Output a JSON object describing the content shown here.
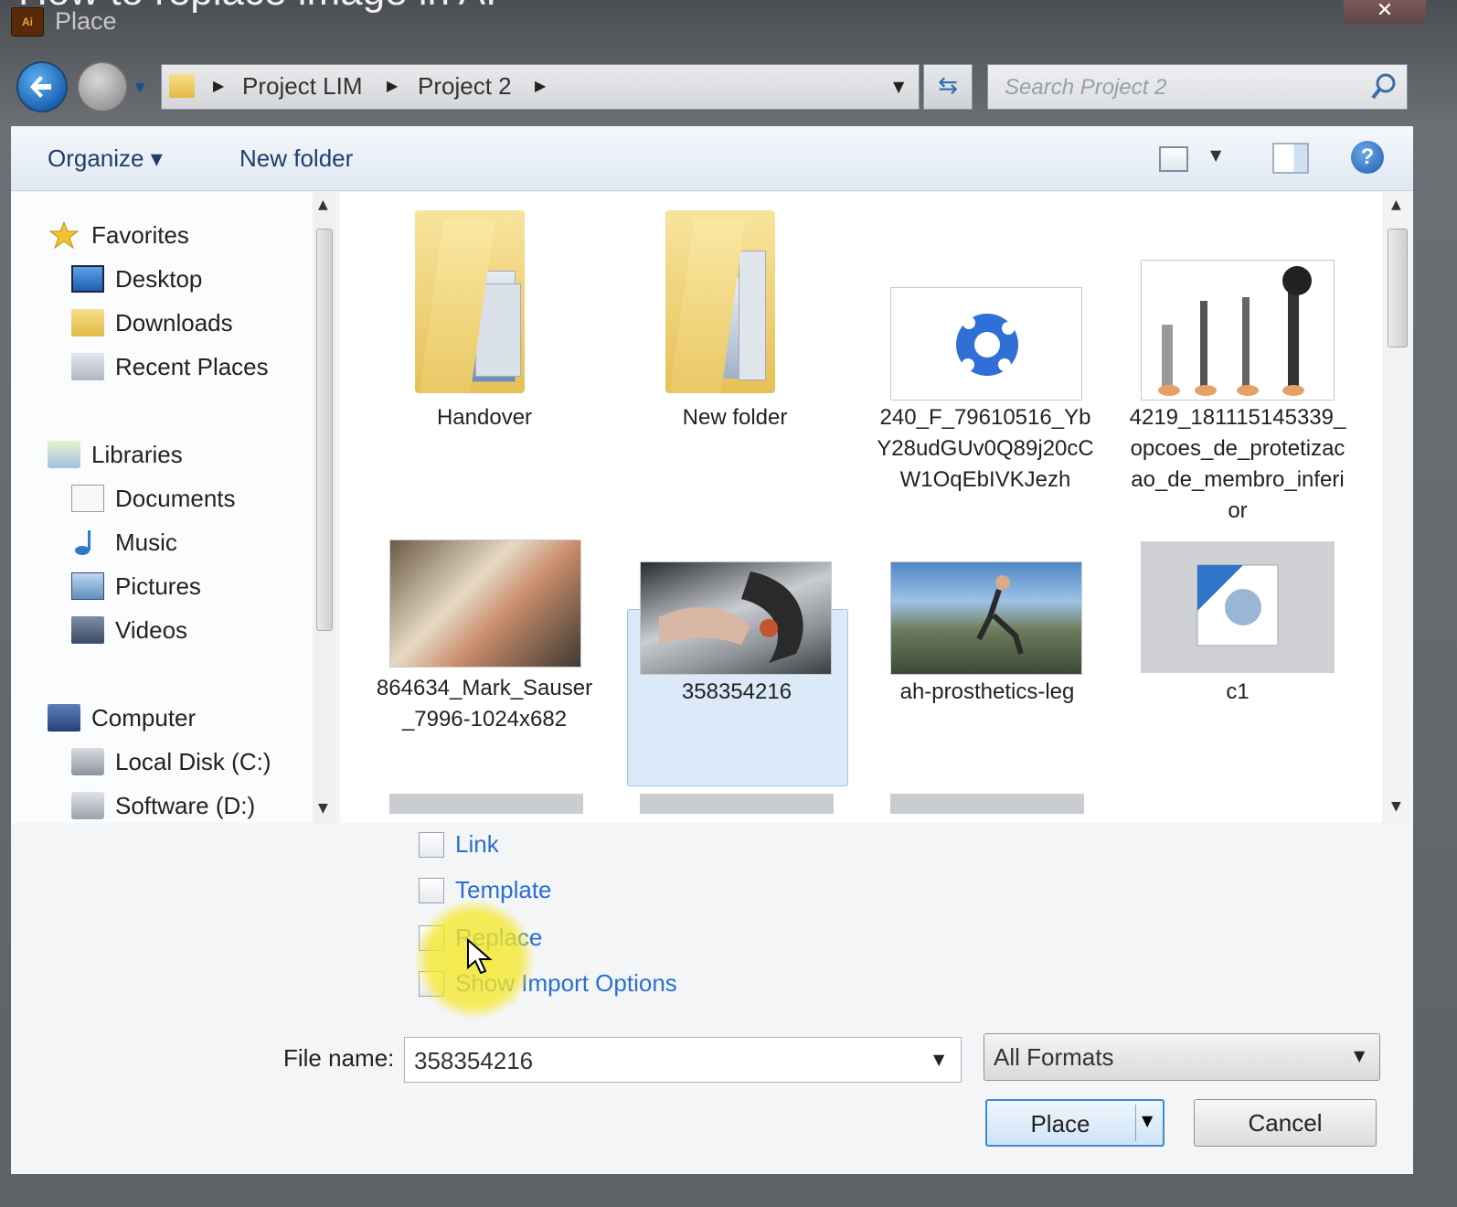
{
  "video_caption": "How to replace image in AI",
  "window": {
    "app_icon_text": "Ai",
    "title": "Place",
    "close_symbol": "✕"
  },
  "address_bar": {
    "breadcrumbs": [
      "Project LIM",
      "Project 2"
    ],
    "search_placeholder": "Search Project 2"
  },
  "toolbar": {
    "organize_label": "Organize ▾",
    "new_folder_label": "New folder",
    "help_label": "?"
  },
  "nav_pane": {
    "favorites": {
      "label": "Favorites",
      "items": [
        "Desktop",
        "Downloads",
        "Recent Places"
      ]
    },
    "libraries": {
      "label": "Libraries",
      "items": [
        "Documents",
        "Music",
        "Pictures",
        "Videos"
      ]
    },
    "computer": {
      "label": "Computer",
      "items": [
        "Local Disk (C:)",
        "Software (D:)"
      ]
    }
  },
  "files": [
    {
      "name": "Handover",
      "kind": "folder"
    },
    {
      "name": "New folder",
      "kind": "folder"
    },
    {
      "name": "240_F_79610516_YbY28udGUv0Q89j20cCW1OqEbIVKJezh",
      "kind": "image"
    },
    {
      "name": "4219_181115145339_opcoes_de_protetizacao_de_membro_inferior",
      "kind": "image"
    },
    {
      "name": "864634_Mark_Sauser_7996-1024x682",
      "kind": "image"
    },
    {
      "name": "358354216",
      "kind": "image",
      "selected": true
    },
    {
      "name": "ah-prosthetics-leg",
      "kind": "image"
    },
    {
      "name": "c1",
      "kind": "image"
    }
  ],
  "options": [
    "Link",
    "Template",
    "Replace",
    "Show Import Options"
  ],
  "file_name": {
    "label": "File name:",
    "value": "358354216"
  },
  "format": {
    "selected": "All Formats"
  },
  "buttons": {
    "place": "Place",
    "cancel": "Cancel"
  }
}
